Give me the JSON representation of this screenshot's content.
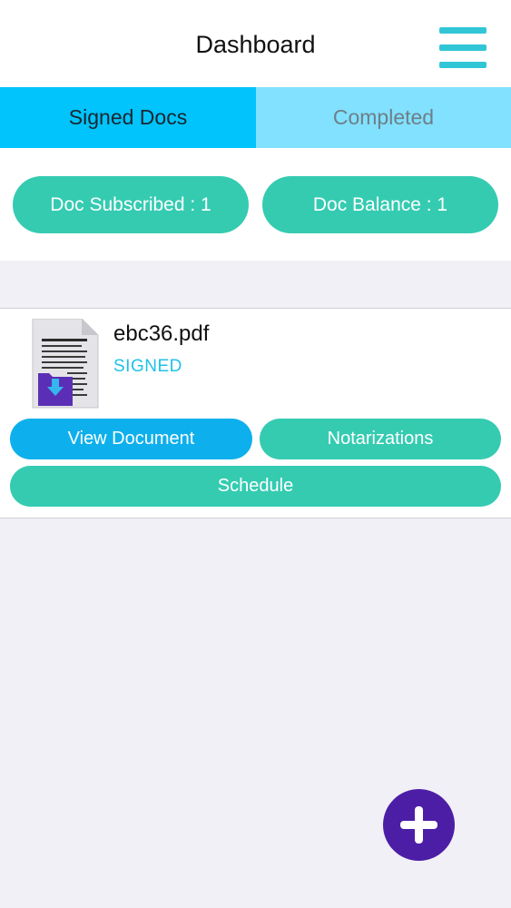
{
  "header": {
    "title": "Dashboard",
    "menu_icon": "hamburger-menu-icon"
  },
  "tabs": [
    {
      "label": "Signed Docs",
      "active": true
    },
    {
      "label": "Completed",
      "active": false
    }
  ],
  "stats": {
    "subscribed": "Doc Subscribed : 1",
    "balance": "Doc Balance : 1"
  },
  "documents": [
    {
      "name": "ebc36.pdf",
      "status": "SIGNED",
      "icon": "pdf-document-icon",
      "actions": {
        "view": "View Document",
        "notarizations": "Notarizations",
        "schedule": "Schedule"
      }
    }
  ],
  "fab": {
    "icon": "plus-icon"
  },
  "colors": {
    "tab_active": "#00c4fb",
    "tab_inactive": "#81e1fe",
    "teal": "#35cbb1",
    "blue_button": "#0db0ec",
    "status_text": "#1ec2e6",
    "menu_icon": "#31c6d6",
    "fab": "#4c1ea6",
    "background": "#f1f0f6"
  }
}
